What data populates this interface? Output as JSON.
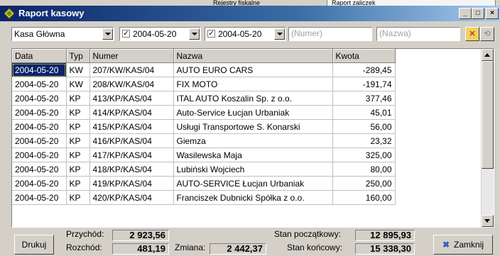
{
  "background": {
    "menu_items": [
      "Rejestry fiskalne",
      "Raport zaliczek"
    ]
  },
  "window": {
    "title": "Raport kasowy",
    "controls": [
      "_",
      "□",
      "×"
    ]
  },
  "toolbar": {
    "register_select": "Kasa Główna",
    "date_from": "2004-05-20",
    "date_to": "2004-05-20",
    "number_placeholder": "(Numer)",
    "name_placeholder": "(Nazwa)"
  },
  "table": {
    "columns": [
      "Data",
      "Typ",
      "Numer",
      "Nazwa",
      "Kwota"
    ],
    "rows": [
      [
        "2004-05-20",
        "KW",
        "207/KW/KAS/04",
        "AUTO EURO CARS",
        "-289,45"
      ],
      [
        "2004-05-20",
        "KW",
        "208/KW/KAS/04",
        "FIX MOTO",
        "-191,74"
      ],
      [
        "2004-05-20",
        "KP",
        "413/KP/KAS/04",
        "ITAL  AUTO Koszalin Sp. z o.o.",
        "377,46"
      ],
      [
        "2004-05-20",
        "KP",
        "414/KP/KAS/04",
        "Auto-Service Łucjan Urbaniak",
        "45,01"
      ],
      [
        "2004-05-20",
        "KP",
        "415/KP/KAS/04",
        "Usługi Transportowe S. Konarski",
        "56,00"
      ],
      [
        "2004-05-20",
        "KP",
        "416/KP/KAS/04",
        "Giemza",
        "23,32"
      ],
      [
        "2004-05-20",
        "KP",
        "417/KP/KAS/04",
        "Wasilewska Maja",
        "325,00"
      ],
      [
        "2004-05-20",
        "KP",
        "418/KP/KAS/04",
        "Lubiński Wojciech",
        "80,00"
      ],
      [
        "2004-05-20",
        "KP",
        "419/KP/KAS/04",
        "AUTO-SERVICE  Łucjan Urbaniak",
        "250,00"
      ],
      [
        "2004-05-20",
        "KP",
        "420/KP/KAS/04",
        "Franciszek Dubnicki Spółka z o.o.",
        "160,00"
      ]
    ]
  },
  "footer": {
    "print_label": "Drukuj",
    "income_label": "Przychód:",
    "income_value": "2 923,56",
    "expense_label": "Rozchód:",
    "expense_value": "481,19",
    "change_label": "Zmiana:",
    "change_value": "2 442,37",
    "opening_label": "Stan początkowy:",
    "opening_value": "12 895,93",
    "closing_label": "Stan końcowy:",
    "closing_value": "15 338,30",
    "close_label": "Zamknij"
  },
  "colors": {
    "title_bar": "#0a246a",
    "selection": "#0a246a",
    "face": "#d4d0c8"
  }
}
